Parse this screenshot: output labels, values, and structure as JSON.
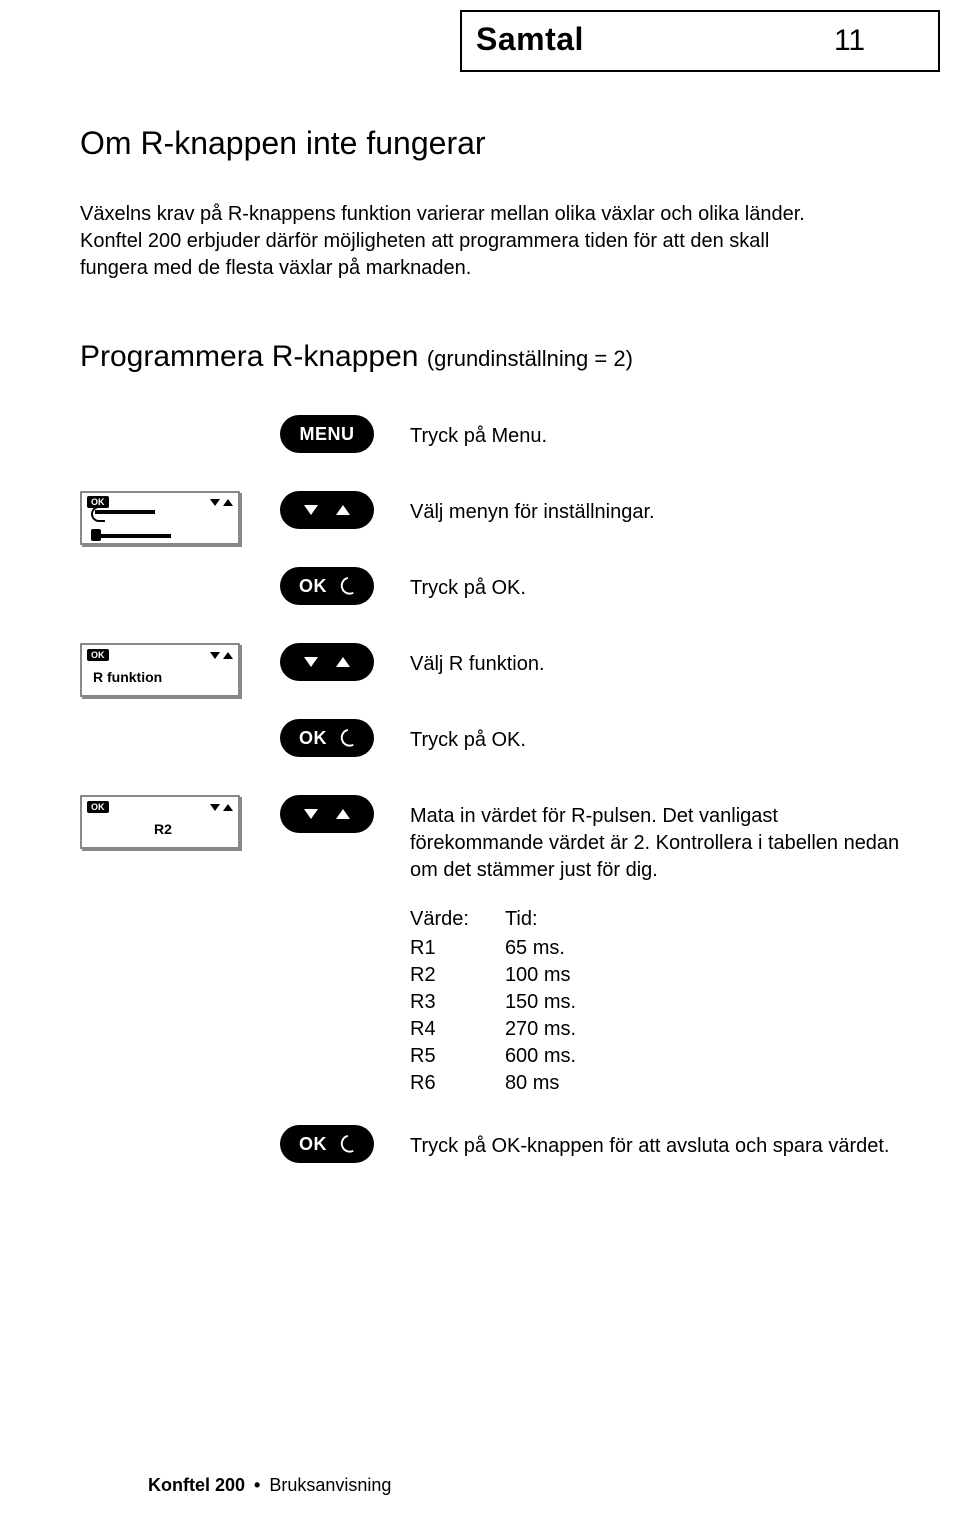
{
  "header": {
    "section": "Samtal",
    "page_number": "11"
  },
  "h2": "Om R-knappen inte fungerar",
  "intro": "Växelns krav på R-knappens funktion varierar mellan olika växlar och olika länder. Konftel 200 erbjuder därför möjligheten att programmera tiden för att den skall fungera med de flesta växlar på marknaden.",
  "h3_main": "Programmera R-knappen",
  "h3_note": "(grundinställning = 2)",
  "buttons": {
    "menu": "MENU",
    "ok": "OK"
  },
  "lcd": {
    "ok_badge": "OK",
    "r_funktion": "R funktion",
    "r2": "R2"
  },
  "steps": {
    "s1": "Tryck på Menu.",
    "s2": "Välj menyn för inställningar.",
    "s3": "Tryck på OK.",
    "s4": "Välj R funktion.",
    "s5": "Tryck på OK.",
    "s6": "Mata in värdet för R-pulsen. Det vanligast förekommande värdet är 2. Kontrollera i tabellen nedan om det stämmer just för dig.",
    "s7": "Tryck på OK-knappen för att avsluta och spara värdet."
  },
  "table": {
    "value_head": "Värde:",
    "time_head": "Tid:",
    "rows": {
      "r1v": "R1",
      "r1t": "65 ms.",
      "r2v": "R2",
      "r2t": "100 ms",
      "r3v": "R3",
      "r3t": "150 ms.",
      "r4v": "R4",
      "r4t": "270 ms.",
      "r5v": "R5",
      "r5t": "600 ms.",
      "r6v": "R6",
      "r6t": "80 ms"
    }
  },
  "footer": {
    "product": "Konftel 200",
    "sep": "•",
    "doc": "Bruksanvisning"
  }
}
